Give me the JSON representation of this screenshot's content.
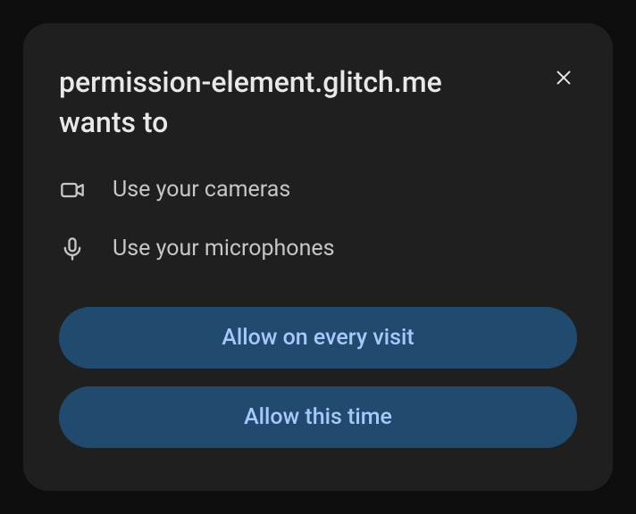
{
  "dialog": {
    "origin": "permission-element.glitch.me",
    "title_suffix": "wants to",
    "permissions": [
      {
        "icon": "camera-icon",
        "label": "Use your cameras"
      },
      {
        "icon": "microphone-icon",
        "label": "Use your microphones"
      }
    ],
    "buttons": {
      "allow_always": "Allow on every visit",
      "allow_once": "Allow this time"
    }
  }
}
